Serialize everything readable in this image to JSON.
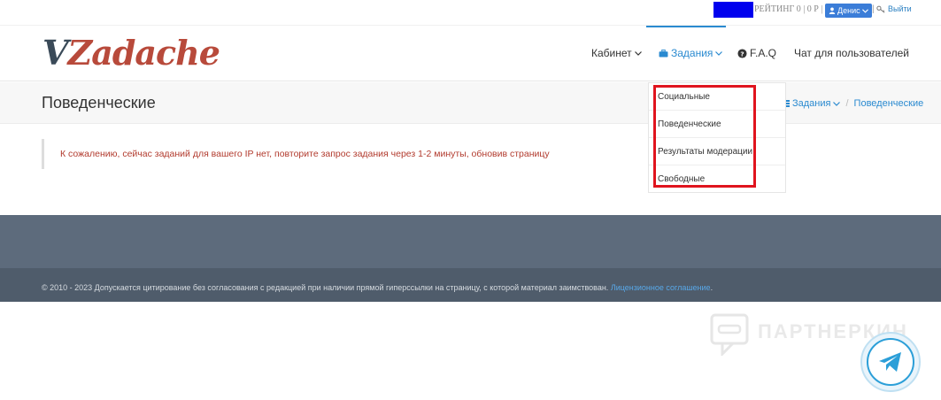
{
  "topbar": {
    "rating_text": "РЕЙТИНГ 0 | 0 Р |",
    "user_label": "Денис",
    "separator": "|",
    "logout_label": "Выйти"
  },
  "header": {
    "logo_v": "V",
    "logo_rest": "Zadache",
    "nav": {
      "cabinet": "Кабинет",
      "tasks": "Задания",
      "faq": "F.A.Q",
      "chat": "Чат для пользователей"
    }
  },
  "page": {
    "title": "Поведенческие",
    "breadcrumb": {
      "tasks": "Задания",
      "slash": "/",
      "current": "Поведенческие"
    }
  },
  "dropdown": {
    "items": [
      "Социальные",
      "Поведенческие",
      "Результаты модерации",
      "Свободные"
    ]
  },
  "alert": {
    "message": "К сожалению, сейчас заданий для вашего IP нет, повторите запрос задания через 1-2 минуты, обновив страницу"
  },
  "footer": {
    "copyright": "© 2010 - 2023 Допускается цитирование без согласования с редакцией при наличии прямой гиперссылки на страницу, с которой материал заимствован.",
    "license_link": "Лицензионное соглашение",
    "period": "."
  },
  "watermark": {
    "text": "ПАРТНЕРКИН"
  },
  "colors": {
    "accent": "#2a8ad0",
    "logo_red": "#b84a3b",
    "alert_red": "#b23b2e",
    "highlight_red": "#e0141e",
    "footer_dark": "#4f5c6b",
    "footer_mid": "#5d6b7c"
  }
}
